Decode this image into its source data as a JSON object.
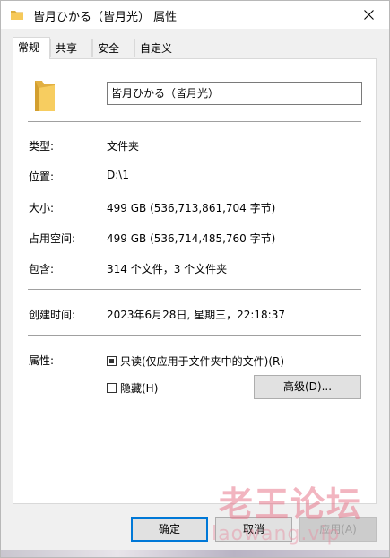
{
  "window": {
    "title": "皆月ひかる（皆月光） 属性",
    "close_icon": "close-icon",
    "folder_icon": "folder-icon"
  },
  "tabs": [
    {
      "label": "常规",
      "active": true
    },
    {
      "label": "共享",
      "active": false
    },
    {
      "label": "安全",
      "active": false
    },
    {
      "label": "自定义",
      "active": false
    }
  ],
  "general": {
    "name_value": "皆月ひかる（皆月光）",
    "rows": {
      "type": {
        "label": "类型:",
        "value": "文件夹"
      },
      "location": {
        "label": "位置:",
        "value": "D:\\1"
      },
      "size": {
        "label": "大小:",
        "value": "499 GB (536,713,861,704 字节)"
      },
      "size_on_disk": {
        "label": "占用空间:",
        "value": "499 GB (536,714,485,760 字节)"
      },
      "contains": {
        "label": "包含:",
        "value": "314 个文件，3 个文件夹"
      },
      "created": {
        "label": "创建时间:",
        "value": "2023年6月28日, 星期三，22:18:37"
      }
    },
    "attributes": {
      "label": "属性:",
      "readonly_label": "只读(仅应用于文件夹中的文件)(R)",
      "readonly_state": "indeterminate",
      "hidden_label": "隐藏(H)",
      "hidden_checked": false,
      "advanced_button": "高级(D)..."
    }
  },
  "buttons": {
    "ok": "确定",
    "cancel": "取消",
    "apply": "应用(A)"
  },
  "watermark": {
    "cn": "老王论坛",
    "en": "laowang.vip"
  },
  "colors": {
    "accent": "#0078d7",
    "folder": "#f3c14b",
    "watermark": "#e8788c"
  }
}
